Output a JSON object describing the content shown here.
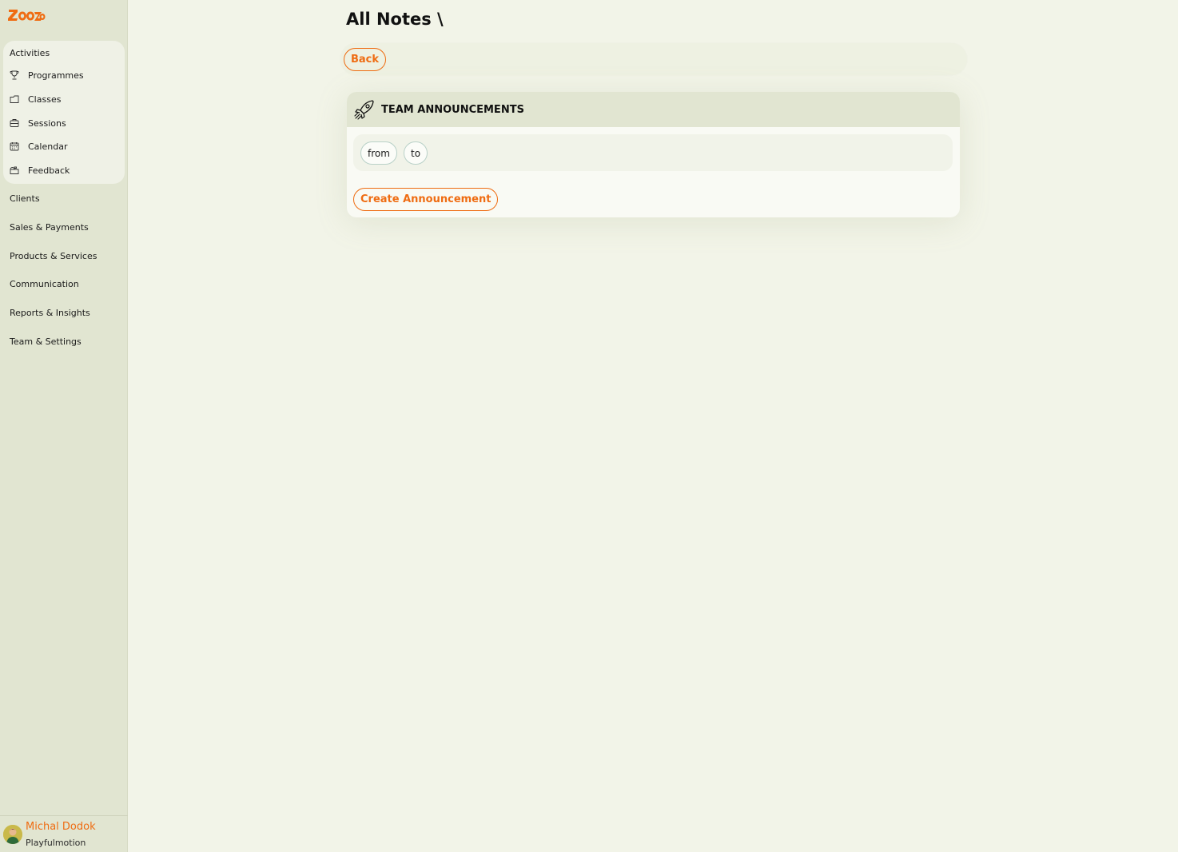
{
  "brand": {
    "logo_text": "Zooza",
    "accent_color": "#ef6c12"
  },
  "sidebar": {
    "activities": {
      "title": "Activities",
      "items": [
        {
          "label": "Programmes",
          "icon": "trophy-icon"
        },
        {
          "label": "Classes",
          "icon": "folder-icon"
        },
        {
          "label": "Sessions",
          "icon": "briefcase-icon"
        },
        {
          "label": "Calendar",
          "icon": "calendar-icon"
        },
        {
          "label": "Feedback",
          "icon": "mailbox-icon"
        }
      ]
    },
    "nav": [
      {
        "label": "Clients"
      },
      {
        "label": "Sales & Payments"
      },
      {
        "label": "Products & Services"
      },
      {
        "label": "Communication"
      },
      {
        "label": "Reports & Insights"
      },
      {
        "label": "Team & Settings"
      }
    ],
    "user": {
      "name": "Michal Dodok",
      "org": "Playfulmotion"
    }
  },
  "main": {
    "title": "All Notes \\",
    "back_label": "Back",
    "card": {
      "title": "TEAM ANNOUNCEMENTS",
      "icon": "rocket-icon",
      "filters": {
        "from": "from",
        "to": "to"
      },
      "create_label": "Create Announcement"
    }
  }
}
